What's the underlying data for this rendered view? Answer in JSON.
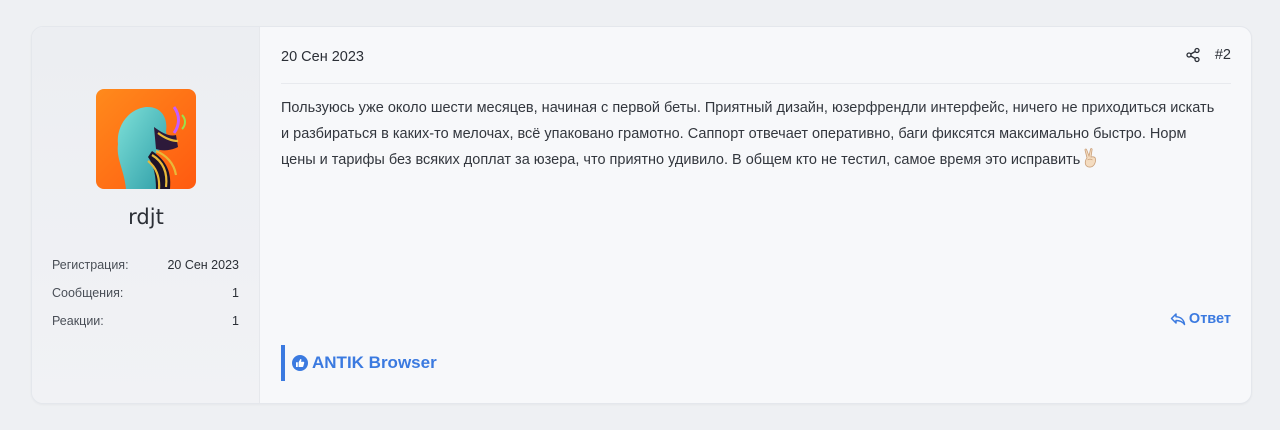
{
  "user": {
    "name": "rdjt",
    "stats": [
      {
        "label": "Регистрация:",
        "value": "20 Сен 2023"
      },
      {
        "label": "Сообщения:",
        "value": "1"
      },
      {
        "label": "Реакции:",
        "value": "1"
      }
    ]
  },
  "post": {
    "date": "20 Сен 2023",
    "number": "#2",
    "body": "Пользуюсь уже около шести месяцев, начиная с первой беты. Приятный дизайн, юзерфрендли интерфейс, ничего не приходиться искать и разбираться в каких-то мелочах, всё упаковано грамотно. Саппорт отвечает оперативно, баги фиксятся максимально быстро. Норм цены и тарифы без всяких доплат за юзера, что приятно удивило. В общем кто не тестил, самое время это исправить",
    "emoji": "victory-hand-icon",
    "reply_label": "Ответ",
    "reaction_user": "ANTIK Browser"
  },
  "colors": {
    "accent": "#3b7ae0",
    "background": "#eef0f3",
    "card": "#f7f8fa"
  }
}
